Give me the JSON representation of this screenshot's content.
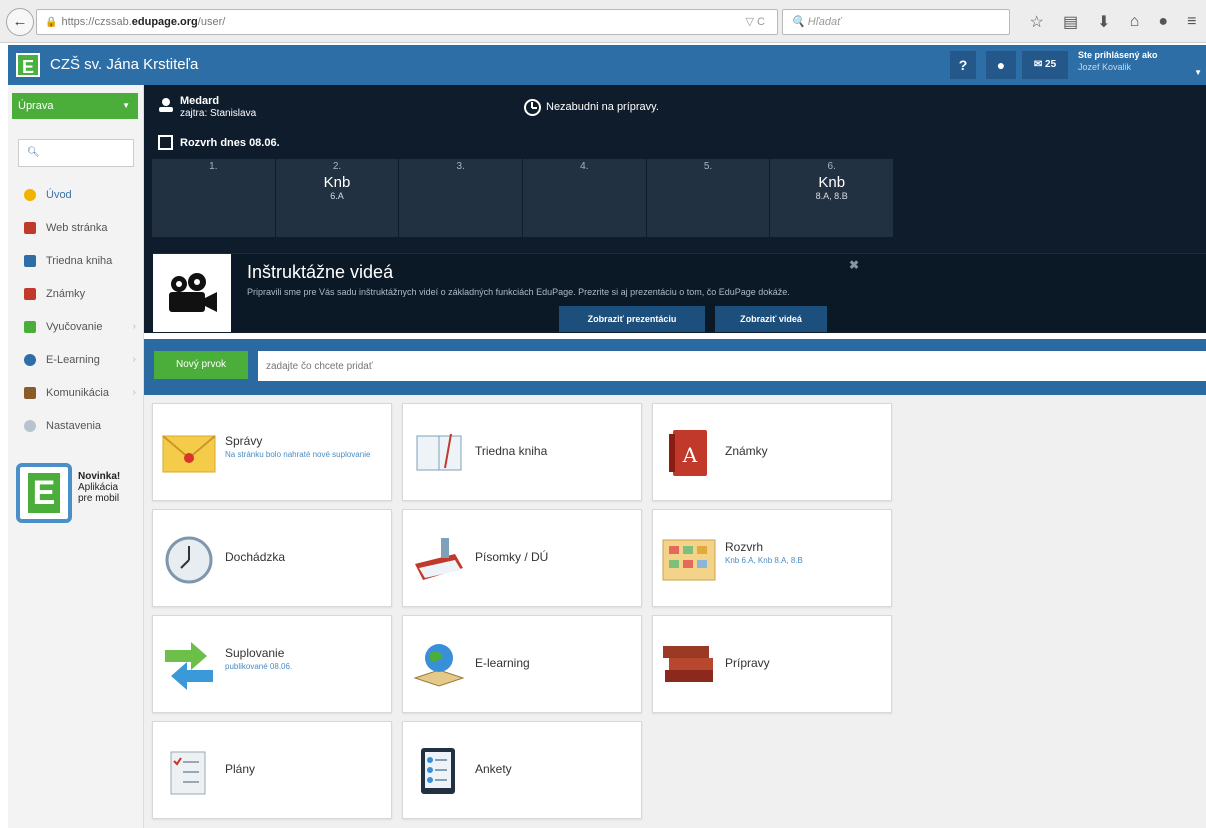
{
  "browser": {
    "url_prefix": "https://czssab.",
    "url_host": "edupage.org",
    "url_path": "/user/",
    "search_placeholder": "Hľadať"
  },
  "header": {
    "logo_letter": "E",
    "school_title": "CZŠ sv. Jána Krstiteľa",
    "help_label": "?",
    "message_count": "25",
    "logged_in_label": "Ste prihlásený ako",
    "user_name": "Jozef Kovalik"
  },
  "sidebar": {
    "edit_label": "Úprava",
    "items": [
      {
        "label": "Úvod",
        "color": "#f2b200",
        "active": true
      },
      {
        "label": "Web stránka",
        "color": "#c0392b"
      },
      {
        "label": "Triedna kniha",
        "color": "#2e6ea6"
      },
      {
        "label": "Známky",
        "color": "#c0392b"
      },
      {
        "label": "Vyučovanie",
        "color": "#4cae3a"
      },
      {
        "label": "E-Learning",
        "color": "#2e6ea6"
      },
      {
        "label": "Komunikácia",
        "color": "#8a5a2b"
      },
      {
        "label": "Nastavenia",
        "color": "#9ab"
      }
    ],
    "promo_title": "Novinka!",
    "promo_line1": "Aplikácia",
    "promo_line2": "pre mobil"
  },
  "panel": {
    "nameday_today": "Medard",
    "nameday_tomorrow": "zajtra: Stanislava",
    "reminder": "Nezabudni na prípravy.",
    "schedule_title": "Rozvrh dnes 08.06.",
    "lessons": [
      {
        "num": "1.",
        "subject": "",
        "class": ""
      },
      {
        "num": "2.",
        "subject": "Knb",
        "class": "6.A"
      },
      {
        "num": "3.",
        "subject": "",
        "class": ""
      },
      {
        "num": "4.",
        "subject": "",
        "class": ""
      },
      {
        "num": "5.",
        "subject": "",
        "class": ""
      },
      {
        "num": "6.",
        "subject": "Knb",
        "class": "8.A, 8.B"
      }
    ]
  },
  "promo": {
    "title": "Inštruktážne videá",
    "text": "Pripravili sme pre Vás sadu inštruktážnych videí o základných funkciách EduPage. Prezrite si aj prezentáciu o tom, čo EduPage dokáže.",
    "btn_presentation": "Zobraziť prezentáciu",
    "btn_videos": "Zobraziť videá",
    "close": "✖"
  },
  "newbar": {
    "button": "Nový prvok",
    "placeholder": "zadajte čo chcete pridať"
  },
  "tiles": [
    {
      "label": "Správy",
      "sub": "Na stránku bolo nahraté nové suplovanie"
    },
    {
      "label": "Triedna kniha",
      "sub": ""
    },
    {
      "label": "Známky",
      "sub": ""
    },
    {
      "label": "Dochádzka",
      "sub": ""
    },
    {
      "label": "Písomky / DÚ",
      "sub": ""
    },
    {
      "label": "Rozvrh",
      "sub": "Knb 6.A, Knb 8.A, 8.B"
    },
    {
      "label": "Suplovanie",
      "sub": "publikované 08.06."
    },
    {
      "label": "E-learning",
      "sub": ""
    },
    {
      "label": "Prípravy",
      "sub": ""
    },
    {
      "label": "Plány",
      "sub": ""
    },
    {
      "label": "Ankety",
      "sub": ""
    }
  ]
}
